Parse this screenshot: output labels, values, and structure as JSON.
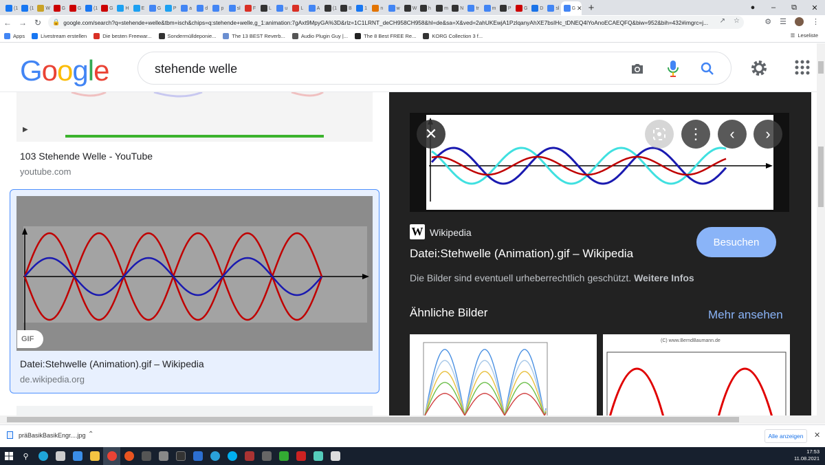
{
  "browser": {
    "tabs": [
      {
        "label": "(1",
        "color": "#1877f2"
      },
      {
        "label": "(1",
        "color": "#1877f2"
      },
      {
        "label": "W",
        "color": "#c9a227"
      },
      {
        "label": "G",
        "color": "#cc0000"
      },
      {
        "label": "G",
        "color": "#cc0000"
      },
      {
        "label": "(1",
        "color": "#1877f2"
      },
      {
        "label": "G",
        "color": "#cc0000"
      },
      {
        "label": "H",
        "color": "#1da1f2"
      },
      {
        "label": "E",
        "color": "#1da1f2"
      },
      {
        "label": "G",
        "color": "#4285f4"
      },
      {
        "label": "P",
        "color": "#1da1f2"
      },
      {
        "label": "a",
        "color": "#4285f4"
      },
      {
        "label": "d",
        "color": "#4285f4"
      },
      {
        "label": "p",
        "color": "#4285f4"
      },
      {
        "label": "sl",
        "color": "#4285f4"
      },
      {
        "label": "F",
        "color": "#d93025"
      },
      {
        "label": "L",
        "color": "#333333"
      },
      {
        "label": "u",
        "color": "#4285f4"
      },
      {
        "label": "L",
        "color": "#d93025"
      },
      {
        "label": "A",
        "color": "#4285f4"
      },
      {
        "label": "(1",
        "color": "#333333"
      },
      {
        "label": "B",
        "color": "#333333"
      },
      {
        "label": "1",
        "color": "#1877f2"
      },
      {
        "label": "n",
        "color": "#e37400"
      },
      {
        "label": "w",
        "color": "#4285f4"
      },
      {
        "label": "W",
        "color": "#333333"
      },
      {
        "label": "h",
        "color": "#333333"
      },
      {
        "label": "m",
        "color": "#333333"
      },
      {
        "label": "N",
        "color": "#333333"
      },
      {
        "label": "tr",
        "color": "#4285f4"
      },
      {
        "label": "m",
        "color": "#4285f4"
      },
      {
        "label": "P",
        "color": "#333333"
      },
      {
        "label": "G",
        "color": "#cc0000"
      },
      {
        "label": "D",
        "color": "#1a73e8"
      },
      {
        "label": "sl",
        "color": "#4285f4"
      }
    ],
    "active_tab": {
      "label": "G",
      "color": "#4285f4"
    },
    "new_tab": "+",
    "url": "google.com/search?q=stehende+welle&tbm=isch&chips=q:stehende+welle,g_1:animation:7gAxt9MpyGA%3D&rlz=1C1LRNT_deCH958CH958&hl=de&sa=X&ved=2ahUKEwjA1PzlqanyAhXE7bsIHc_tDNEQ4lYoAnoECAEQFQ&biw=952&bih=432#imgrc=j...",
    "bookmarks": [
      {
        "label": "Apps",
        "color": "#4285f4"
      },
      {
        "label": "Livestream erstellen",
        "color": "#1877f2"
      },
      {
        "label": "Die besten Freewar...",
        "color": "#d93025"
      },
      {
        "label": "Sondermülldeponie...",
        "color": "#333333"
      },
      {
        "label": "The 13 BEST Reverb...",
        "color": "#6b8fd1"
      },
      {
        "label": "Audio Plugin Guy |...",
        "color": "#555555"
      },
      {
        "label": "The 8 Best FREE Re...",
        "color": "#222222"
      },
      {
        "label": "KORG Collection 3 f...",
        "color": "#333333"
      }
    ],
    "reading_list": "Leseliste"
  },
  "google": {
    "logo": "Google",
    "query": "stehende welle"
  },
  "results": {
    "youtube": {
      "title": "103 Stehende Welle - YouTube",
      "source": "youtube.com"
    },
    "wiki": {
      "title": "Datei:Stehwelle (Animation).gif – Wikipedia",
      "source": "de.wikipedia.org",
      "badge": "GIF"
    }
  },
  "preview": {
    "site": "Wikipedia",
    "logo_letter": "W",
    "visit_button": "Besuchen",
    "title": "Datei:Stehwelle (Animation).gif – Wikipedia",
    "rights_text": "Die Bilder sind eventuell urheberrechtlich geschützt.",
    "more_info": "Weitere Infos",
    "similar_heading": "Ähnliche Bilder",
    "see_more": "Mehr ansehen",
    "similar2_caption": "(C) www.BerndBaumann.de"
  },
  "download": {
    "file": "präBasikBasikEngr....jpg",
    "show_all": "Alle anzeigen"
  },
  "taskbar": {
    "time": "17:53",
    "date": "11.08.2021"
  },
  "colors": {
    "red_wave": "#c00000",
    "blue_wave": "#1a1ab0",
    "cyan_wave": "#40e0e0"
  }
}
